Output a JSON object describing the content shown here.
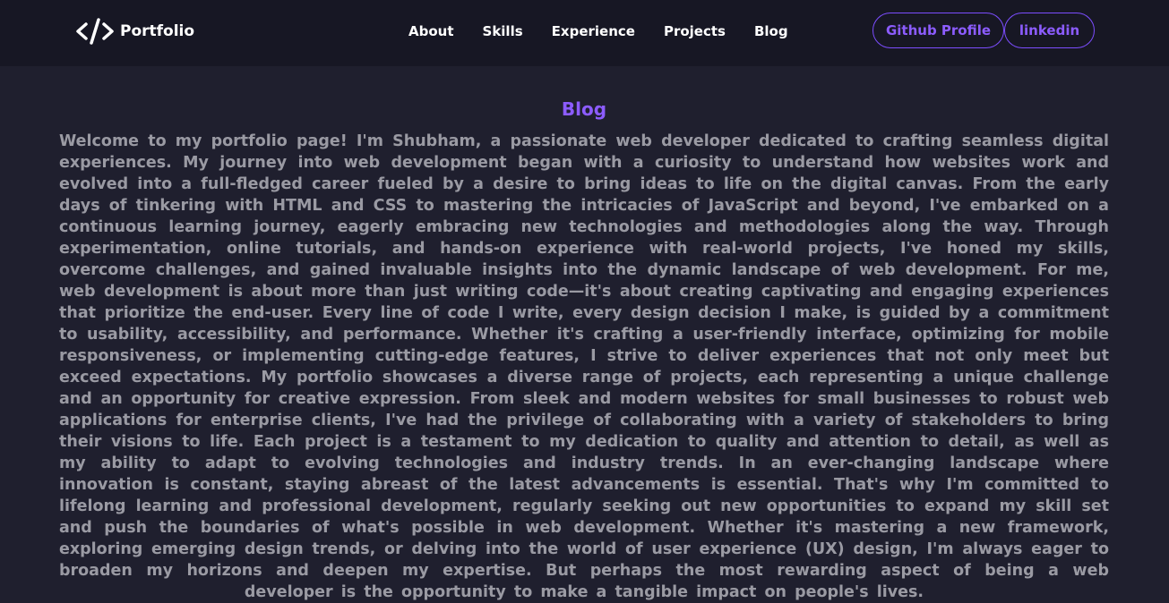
{
  "navbar": {
    "brand": {
      "icon": "code-slash-icon",
      "text": "Portfolio"
    },
    "links": [
      "About",
      "Skills",
      "Experience",
      "Projects",
      "Blog"
    ],
    "buttons": {
      "github": "Github Profile",
      "linkedin": "linkedin"
    }
  },
  "main": {
    "title": "Blog",
    "body": "Welcome to my portfolio page! I'm Shubham, a passionate web developer dedicated to crafting seamless digital experiences. My journey into web development began with a curiosity to understand how websites work and evolved into a full-fledged career fueled by a desire to bring ideas to life on the digital canvas. From the early days of tinkering with HTML and CSS to mastering the intricacies of JavaScript and beyond, I've embarked on a continuous learning journey, eagerly embracing new technologies and methodologies along the way. Through experimentation, online tutorials, and hands-on experience with real-world projects, I've honed my skills, overcome challenges, and gained invaluable insights into the dynamic landscape of web development. For me, web development is about more than just writing code—it's about creating captivating and engaging experiences that prioritize the end-user. Every line of code I write, every design decision I make, is guided by a commitment to usability, accessibility, and performance. Whether it's crafting a user-friendly interface, optimizing for mobile responsiveness, or implementing cutting-edge features, I strive to deliver experiences that not only meet but exceed expectations. My portfolio showcases a diverse range of projects, each representing a unique challenge and an opportunity for creative expression. From sleek and modern websites for small businesses to robust web applications for enterprise clients, I've had the privilege of collaborating with a variety of stakeholders to bring their visions to life. Each project is a testament to my dedication to quality and attention to detail, as well as my ability to adapt to evolving technologies and industry trends. In an ever-changing landscape where innovation is constant, staying abreast of the latest advancements is essential. That's why I'm committed to lifelong learning and professional development, regularly seeking out new opportunities to expand my skill set and push the boundaries of what's possible in web development. Whether it's mastering a new framework, exploring emerging design trends, or delving into the world of user experience (UX) design, I'm always eager to broaden my horizons and deepen my expertise. But perhaps the most rewarding aspect of being a web developer is the opportunity to make a tangible impact on people's lives."
  },
  "colors": {
    "page_background": "#1f1f2e",
    "navbar_background": "#171724",
    "accent": "#8c5cff",
    "body_text": "#9a9aa3",
    "nav_text": "#ffffff"
  }
}
